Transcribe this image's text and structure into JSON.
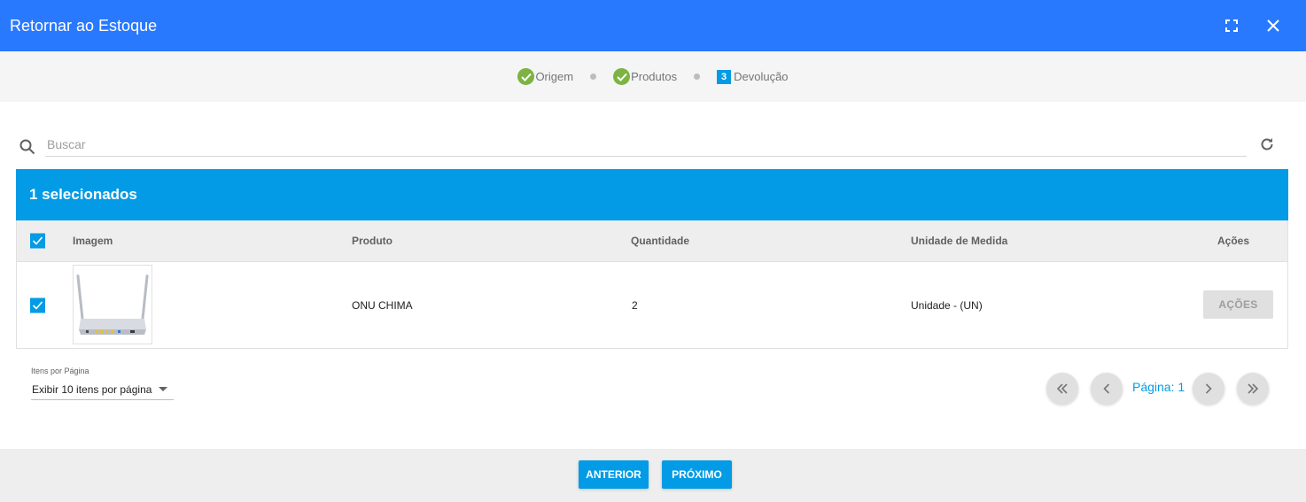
{
  "dialog": {
    "title": "Retornar ao Estoque"
  },
  "stepper": {
    "steps": [
      {
        "label": "Origem",
        "state": "done"
      },
      {
        "label": "Produtos",
        "state": "done"
      },
      {
        "label": "Devolução",
        "state": "active",
        "number": "3"
      }
    ]
  },
  "search": {
    "placeholder": "Buscar",
    "value": ""
  },
  "selection": {
    "text": "1 selecionados"
  },
  "table": {
    "headers": {
      "image": "Imagem",
      "product": "Produto",
      "quantity": "Quantidade",
      "unit": "Unidade de Medida",
      "actions": "Ações"
    },
    "rows": [
      {
        "checked": true,
        "product": "ONU CHIMA",
        "quantity": "2",
        "unit": "Unidade - (UN)",
        "action_label": "AÇÕES"
      }
    ]
  },
  "pagination": {
    "per_page_label": "Itens por Página",
    "per_page_value": "Exibir 10 itens por página",
    "page_label": "Página: 1"
  },
  "footer": {
    "prev_label": "ANTERIOR",
    "next_label": "PRÓXIMO"
  },
  "colors": {
    "header": "#2979ff",
    "accent": "#039be5",
    "success": "#7cb342"
  }
}
